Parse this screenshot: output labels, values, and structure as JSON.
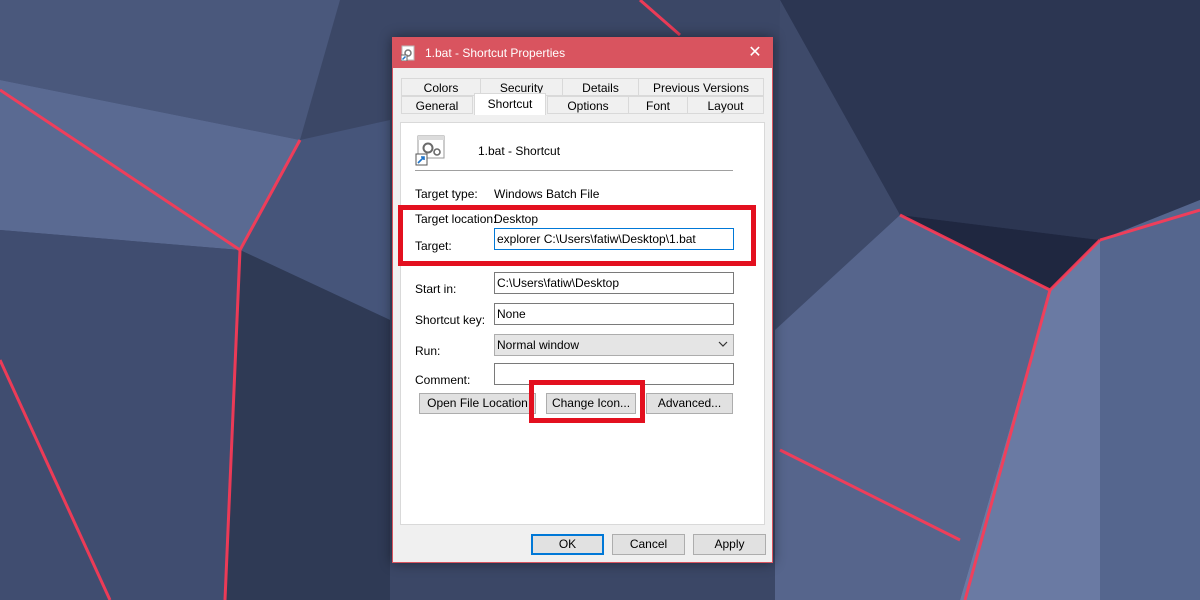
{
  "dialog": {
    "title": "1.bat - Shortcut Properties",
    "close_glyph": "✕",
    "title_icon": "shortcut-file-icon"
  },
  "tabs_row1": [
    "Colors",
    "Security",
    "Details",
    "Previous Versions"
  ],
  "tabs_row2": [
    "General",
    "Shortcut",
    "Options",
    "Font",
    "Layout"
  ],
  "active_tab": "Shortcut",
  "header": {
    "name": "1.bat - Shortcut",
    "icon": "batch-file-gear-icon"
  },
  "fields": {
    "target_type_label": "Target type:",
    "target_type_value": "Windows Batch File",
    "target_location_label": "Target location:",
    "target_location_value": "Desktop",
    "target_label": "Target:",
    "target_value": "explorer C:\\Users\\fatiw\\Desktop\\1.bat",
    "start_in_label": "Start in:",
    "start_in_value": "C:\\Users\\fatiw\\Desktop",
    "shortcut_key_label": "Shortcut key:",
    "shortcut_key_value": "None",
    "run_label": "Run:",
    "run_value": "Normal window",
    "comment_label": "Comment:",
    "comment_value": ""
  },
  "buttons": {
    "open_file_location": "Open File Location",
    "change_icon": "Change Icon...",
    "advanced": "Advanced...",
    "ok": "OK",
    "cancel": "Cancel",
    "apply": "Apply"
  },
  "colors": {
    "titlebar": "#d9545f",
    "highlight_box": "#e3101f",
    "focus_border": "#0078d7"
  }
}
